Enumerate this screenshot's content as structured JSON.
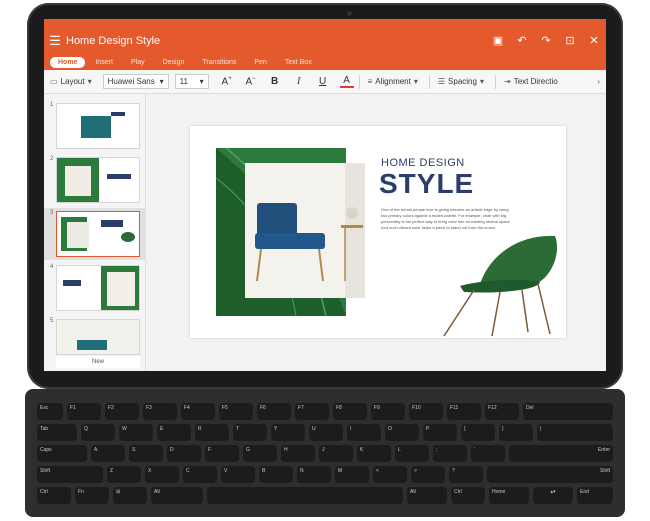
{
  "screen": {
    "status_left": "",
    "status_right": "",
    "app_title": "Home Design Style"
  },
  "tabs": [
    {
      "label": "Home"
    },
    {
      "label": "Insert"
    },
    {
      "label": "Play"
    },
    {
      "label": "Design"
    },
    {
      "label": "Transitions"
    },
    {
      "label": "Pen"
    },
    {
      "label": "Text Box"
    }
  ],
  "toolbar": {
    "layout": "Layout",
    "font": "Huawei Sans",
    "size": "11",
    "alignment": "Alignment",
    "spacing": "Spacing",
    "direction": "Text Directio"
  },
  "thumbnails": [
    {
      "num": "1"
    },
    {
      "num": "2"
    },
    {
      "num": "3"
    },
    {
      "num": "4"
    },
    {
      "num": "5"
    }
  ],
  "new_label": "New",
  "slide": {
    "heading_top": "HOME DESIGN",
    "heading_big": "STYLE",
    "body": "One of the trends people love is giving interiors an artistic edge by using two primary colors against a muted palette. For example, chair with big personality is the perfect way to bring color into an existing neutral space. And such vibrant color helps a piece to stand out from the crowd."
  },
  "colors": {
    "accent": "#e45a2c",
    "navy": "#2b3d6b",
    "green": "#2d7a3d"
  },
  "keys": {
    "row1": [
      "Esc",
      "F1",
      "F2",
      "F3",
      "F4",
      "F5",
      "F6",
      "F7",
      "F8",
      "F9",
      "F10",
      "F11",
      "F12",
      "Del"
    ],
    "row2": [
      "Tab",
      "Q",
      "W",
      "E",
      "R",
      "T",
      "Y",
      "U",
      "I",
      "O",
      "P",
      "{",
      "}",
      "|"
    ],
    "row3": [
      "Caps",
      "A",
      "S",
      "D",
      "F",
      "G",
      "H",
      "J",
      "K",
      "L",
      ";",
      "'",
      "Enter"
    ],
    "row4": [
      "Shift",
      "Z",
      "X",
      "C",
      "V",
      "B",
      "N",
      "M",
      "<",
      ">",
      "?",
      "Shift"
    ],
    "row5": [
      "Ctrl",
      "Fn",
      "Alt",
      "Alt",
      "Ctrl",
      "Home",
      "End"
    ]
  }
}
